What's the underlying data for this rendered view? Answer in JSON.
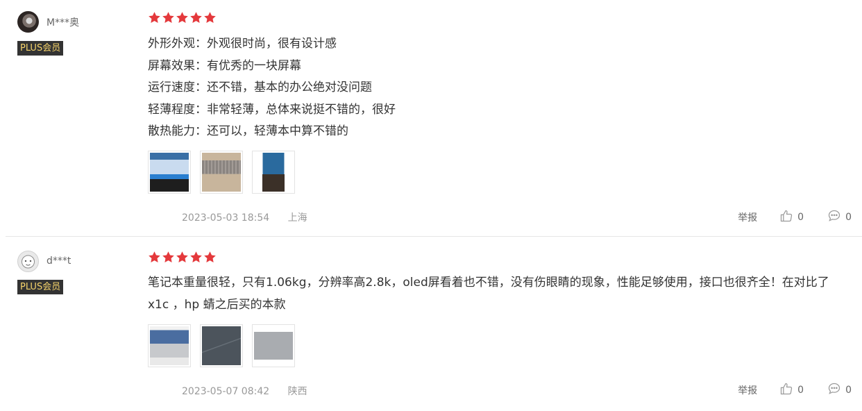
{
  "reviews": [
    {
      "username": "M***奥",
      "badge": "PLUS会员",
      "rating": 5,
      "lines": [
        "外形外观：外观很时尚，很有设计感",
        "屏幕效果：有优秀的一块屏幕",
        "运行速度：还不错，基本的办公绝对没问题",
        "轻薄程度：非常轻薄，总体来说挺不错的，很好",
        "散热能力：还可以，轻薄本中算不错的"
      ],
      "images": [
        "laptop-photo",
        "laptop-photo",
        "laptop-photo"
      ],
      "date": "2023-05-03 18:54",
      "location": "上海",
      "report_label": "举报",
      "likes": "0",
      "replies": "0"
    },
    {
      "username": "d***t",
      "badge": "PLUS会员",
      "rating": 5,
      "lines": [
        "笔记本重量很轻，只有1.06kg，分辨率高2.8k，oled屏看着也不错，没有伤眼睛的现象，性能足够使用，接口也很齐全！在对比了",
        "x1c ，hp 蜻之后买的本款"
      ],
      "images": [
        "laptop-photo",
        "laptop-photo",
        "laptop-photo"
      ],
      "date": "2023-05-07 08:42",
      "location": "陕西",
      "report_label": "举报",
      "likes": "0",
      "replies": "0"
    }
  ],
  "colors": {
    "star": "#e4393c",
    "badge_bg": "#333333",
    "badge_text": "#f5d36b",
    "meta_text": "#999999"
  }
}
